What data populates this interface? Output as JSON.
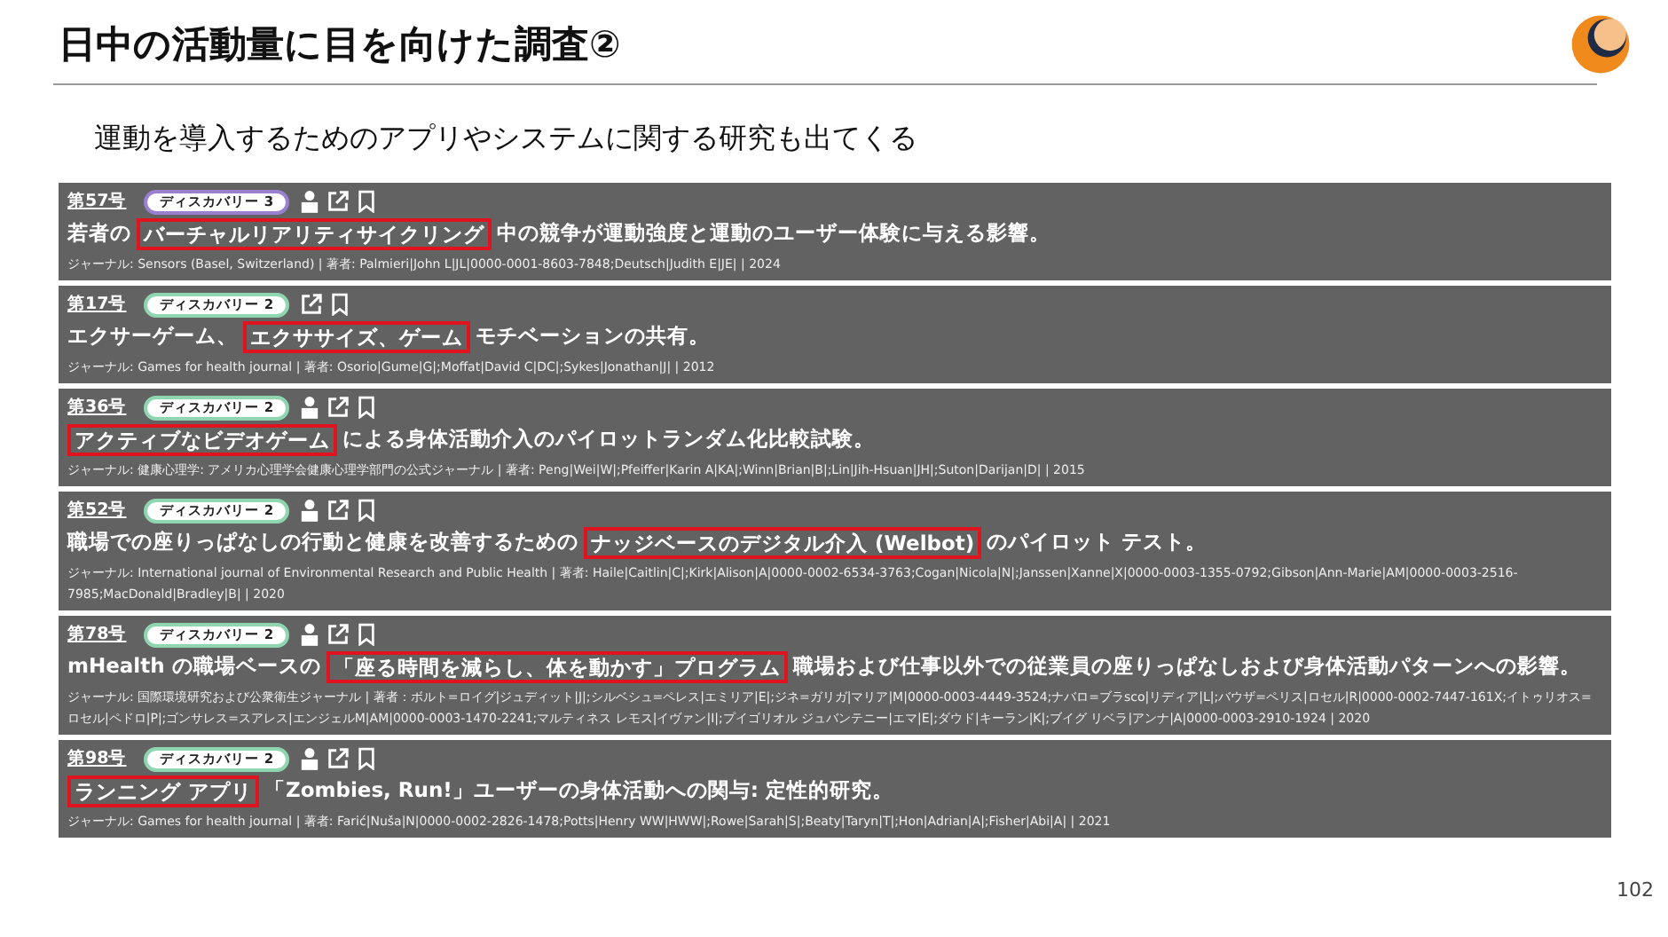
{
  "slide": {
    "title": "日中の活動量に目を向けた調査②",
    "subtitle": "運動を導入するためのアプリやシステムに関する研究も出てくる",
    "page_number": "102"
  },
  "papers": [
    {
      "number": "第57号",
      "badge": {
        "label": "ディスカバリー 3",
        "color": "#9b7fd0"
      },
      "person_icon": true,
      "title_before": "若者の",
      "title_highlight": "バーチャルリアリティサイクリング",
      "title_after": "中の競争が運動強度と運動のユーザー体験に与える影響。",
      "meta": "ジャーナル: Sensors (Basel, Switzerland) | 著者: Palmieri|John L|JL|0000-0001-8603-7848;Deutsch|Judith E|JE| | 2024"
    },
    {
      "number": "第17号",
      "badge": {
        "label": "ディスカバリー 2",
        "color": "#8fd6b0"
      },
      "person_icon": false,
      "title_before": "エクサーゲーム、",
      "title_highlight": "エクササイズ、ゲーム",
      "title_after": "モチベーションの共有。",
      "meta": "ジャーナル: Games for health journal | 著者: Osorio|Gume|G|;Moffat|David C|DC|;Sykes|Jonathan|J| | 2012"
    },
    {
      "number": "第36号",
      "badge": {
        "label": "ディスカバリー 2",
        "color": "#8fd6b0"
      },
      "person_icon": true,
      "title_highlight": "アクティブなビデオゲーム",
      "title_after": "による身体活動介入のパイロットランダム化比較試験。",
      "meta": "ジャーナル: 健康心理学: アメリカ心理学会健康心理学部門の公式ジャーナル | 著者: Peng|Wei|W|;Pfeiffer|Karin A|KA|;Winn|Brian|B|;Lin|Jih-Hsuan|JH|;Suton|Darijan|D| | 2015"
    },
    {
      "number": "第52号",
      "badge": {
        "label": "ディスカバリー 2",
        "color": "#8fd6b0"
      },
      "person_icon": true,
      "title_before": "職場での座りっぱなしの行動と健康を改善するための",
      "title_highlight": "ナッジベースのデジタル介入 (Welbot)",
      "title_after": "のパイロット テスト。",
      "meta": "ジャーナル: International journal of Environmental Research and Public Health | 著者: Haile|Caitlin|C|;Kirk|Alison|A|0000-0002-6534-3763;Cogan|Nicola|N|;Janssen|Xanne|X|0000-0003-1355-0792;Gibson|Ann-Marie|AM|0000-0003-2516-7985;MacDonald|Bradley|B| | 2020"
    },
    {
      "number": "第78号",
      "badge": {
        "label": "ディスカバリー 2",
        "color": "#8fd6b0"
      },
      "person_icon": true,
      "title_before": "mHealth の職場ベースの",
      "title_highlight": "「座る時間を減らし、体を動かす」プログラム",
      "title_after": "職場および仕事以外での従業員の座りっぱなしおよび身体活動パターンへの影響。",
      "meta": "ジャーナル: 国際環境研究および公衆衛生ジャーナル | 著者：ボルト=ロイグ|ジュディット|J|;シルベシュ=ペレス|エミリア|E|;ジネ=ガリガ|マリア|M|0000-0003-4449-3524;ナバロ=ブラsco|リディア|L|;バウザ=ペリス|ロセル|R|0000-0002-7447-161X;イトゥリオス=ロセル|ペドロ|P|;ゴンサレス=スアレス|エンジェルM|AM|0000-0003-1470-2241;マルティネス レモス|イヴァン|I|;プイゴリオル ジュバンテニー|エマ|E|;ダウド|キーラン|K|;ブイグ リベラ|アンナ|A|0000-0003-2910-1924 | 2020"
    },
    {
      "number": "第98号",
      "badge": {
        "label": "ディスカバリー 2",
        "color": "#8fd6b0"
      },
      "person_icon": true,
      "title_highlight": "ランニング アプリ",
      "title_after": "「Zombies, Run!」ユーザーの身体活動への関与: 定性的研究。",
      "meta": "ジャーナル: Games for health journal | 著者: Farić|Nuša|N|0000-0002-2826-1478;Potts|Henry WW|HWW|;Rowe|Sarah|S|;Beaty|Taryn|T|;Hon|Adrian|A|;Fisher|Abi|A| | 2021"
    }
  ]
}
